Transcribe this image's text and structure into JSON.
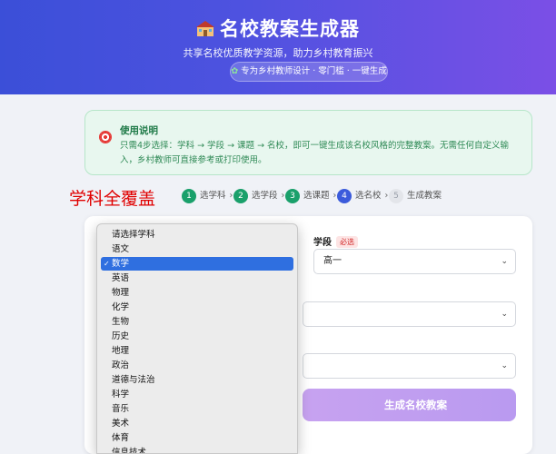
{
  "header": {
    "title": "名校教案生成器",
    "subtitle": "共享名校优质教学资源，助力乡村教育振兴",
    "pill": "专为乡村教师设计 · 零门槛 · 一键生成",
    "colors": {
      "gradient_start": "#3b4fd8",
      "gradient_end": "#7b4fe6"
    }
  },
  "info": {
    "title": "使用说明",
    "text": "只需4步选择：学科 → 学段 → 课题 → 名校，即可一键生成该名校风格的完整教案。无需任何自定义输入，乡村教师可直接参考或打印使用。"
  },
  "annotation": "学科全覆盖",
  "steps": [
    {
      "num": "1",
      "label": "选学科",
      "state": "done"
    },
    {
      "num": "2",
      "label": "选学段",
      "state": "done"
    },
    {
      "num": "3",
      "label": "选课题",
      "state": "done"
    },
    {
      "num": "4",
      "label": "选名校",
      "state": "active"
    },
    {
      "num": "5",
      "label": "生成教案",
      "state": "todo"
    }
  ],
  "form": {
    "stage_label": "学段",
    "required_badge": "必选",
    "stage_value": "高一",
    "generate_button": "生成名校教案"
  },
  "subject_dropdown": {
    "selected": "数学",
    "options": [
      "请选择学科",
      "语文",
      "数学",
      "英语",
      "物理",
      "化学",
      "生物",
      "历史",
      "地理",
      "政治",
      "道德与法治",
      "科学",
      "音乐",
      "美术",
      "体育",
      "信息技术"
    ]
  }
}
